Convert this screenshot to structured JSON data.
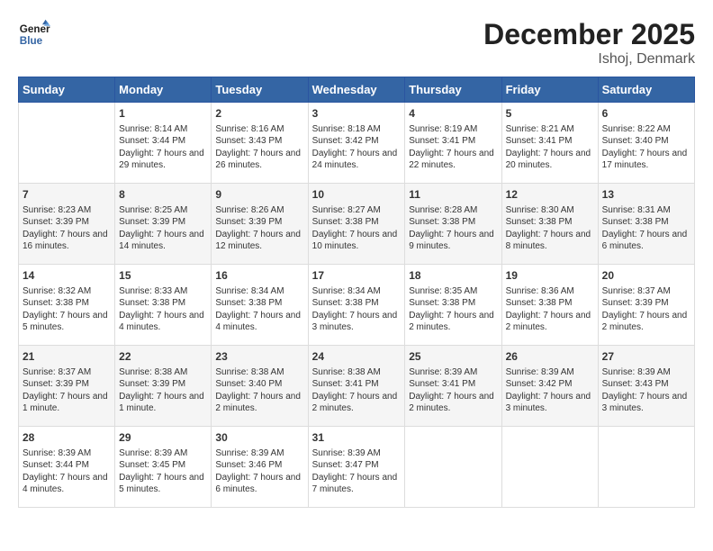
{
  "header": {
    "logo_line1": "General",
    "logo_line2": "Blue",
    "month_title": "December 2025",
    "location": "Ishoj, Denmark"
  },
  "weekdays": [
    "Sunday",
    "Monday",
    "Tuesday",
    "Wednesday",
    "Thursday",
    "Friday",
    "Saturday"
  ],
  "weeks": [
    [
      {
        "day": "",
        "sunrise": "",
        "sunset": "",
        "daylight": ""
      },
      {
        "day": "1",
        "sunrise": "Sunrise: 8:14 AM",
        "sunset": "Sunset: 3:44 PM",
        "daylight": "Daylight: 7 hours and 29 minutes."
      },
      {
        "day": "2",
        "sunrise": "Sunrise: 8:16 AM",
        "sunset": "Sunset: 3:43 PM",
        "daylight": "Daylight: 7 hours and 26 minutes."
      },
      {
        "day": "3",
        "sunrise": "Sunrise: 8:18 AM",
        "sunset": "Sunset: 3:42 PM",
        "daylight": "Daylight: 7 hours and 24 minutes."
      },
      {
        "day": "4",
        "sunrise": "Sunrise: 8:19 AM",
        "sunset": "Sunset: 3:41 PM",
        "daylight": "Daylight: 7 hours and 22 minutes."
      },
      {
        "day": "5",
        "sunrise": "Sunrise: 8:21 AM",
        "sunset": "Sunset: 3:41 PM",
        "daylight": "Daylight: 7 hours and 20 minutes."
      },
      {
        "day": "6",
        "sunrise": "Sunrise: 8:22 AM",
        "sunset": "Sunset: 3:40 PM",
        "daylight": "Daylight: 7 hours and 17 minutes."
      }
    ],
    [
      {
        "day": "7",
        "sunrise": "Sunrise: 8:23 AM",
        "sunset": "Sunset: 3:39 PM",
        "daylight": "Daylight: 7 hours and 16 minutes."
      },
      {
        "day": "8",
        "sunrise": "Sunrise: 8:25 AM",
        "sunset": "Sunset: 3:39 PM",
        "daylight": "Daylight: 7 hours and 14 minutes."
      },
      {
        "day": "9",
        "sunrise": "Sunrise: 8:26 AM",
        "sunset": "Sunset: 3:39 PM",
        "daylight": "Daylight: 7 hours and 12 minutes."
      },
      {
        "day": "10",
        "sunrise": "Sunrise: 8:27 AM",
        "sunset": "Sunset: 3:38 PM",
        "daylight": "Daylight: 7 hours and 10 minutes."
      },
      {
        "day": "11",
        "sunrise": "Sunrise: 8:28 AM",
        "sunset": "Sunset: 3:38 PM",
        "daylight": "Daylight: 7 hours and 9 minutes."
      },
      {
        "day": "12",
        "sunrise": "Sunrise: 8:30 AM",
        "sunset": "Sunset: 3:38 PM",
        "daylight": "Daylight: 7 hours and 8 minutes."
      },
      {
        "day": "13",
        "sunrise": "Sunrise: 8:31 AM",
        "sunset": "Sunset: 3:38 PM",
        "daylight": "Daylight: 7 hours and 6 minutes."
      }
    ],
    [
      {
        "day": "14",
        "sunrise": "Sunrise: 8:32 AM",
        "sunset": "Sunset: 3:38 PM",
        "daylight": "Daylight: 7 hours and 5 minutes."
      },
      {
        "day": "15",
        "sunrise": "Sunrise: 8:33 AM",
        "sunset": "Sunset: 3:38 PM",
        "daylight": "Daylight: 7 hours and 4 minutes."
      },
      {
        "day": "16",
        "sunrise": "Sunrise: 8:34 AM",
        "sunset": "Sunset: 3:38 PM",
        "daylight": "Daylight: 7 hours and 4 minutes."
      },
      {
        "day": "17",
        "sunrise": "Sunrise: 8:34 AM",
        "sunset": "Sunset: 3:38 PM",
        "daylight": "Daylight: 7 hours and 3 minutes."
      },
      {
        "day": "18",
        "sunrise": "Sunrise: 8:35 AM",
        "sunset": "Sunset: 3:38 PM",
        "daylight": "Daylight: 7 hours and 2 minutes."
      },
      {
        "day": "19",
        "sunrise": "Sunrise: 8:36 AM",
        "sunset": "Sunset: 3:38 PM",
        "daylight": "Daylight: 7 hours and 2 minutes."
      },
      {
        "day": "20",
        "sunrise": "Sunrise: 8:37 AM",
        "sunset": "Sunset: 3:39 PM",
        "daylight": "Daylight: 7 hours and 2 minutes."
      }
    ],
    [
      {
        "day": "21",
        "sunrise": "Sunrise: 8:37 AM",
        "sunset": "Sunset: 3:39 PM",
        "daylight": "Daylight: 7 hours and 1 minute."
      },
      {
        "day": "22",
        "sunrise": "Sunrise: 8:38 AM",
        "sunset": "Sunset: 3:39 PM",
        "daylight": "Daylight: 7 hours and 1 minute."
      },
      {
        "day": "23",
        "sunrise": "Sunrise: 8:38 AM",
        "sunset": "Sunset: 3:40 PM",
        "daylight": "Daylight: 7 hours and 2 minutes."
      },
      {
        "day": "24",
        "sunrise": "Sunrise: 8:38 AM",
        "sunset": "Sunset: 3:41 PM",
        "daylight": "Daylight: 7 hours and 2 minutes."
      },
      {
        "day": "25",
        "sunrise": "Sunrise: 8:39 AM",
        "sunset": "Sunset: 3:41 PM",
        "daylight": "Daylight: 7 hours and 2 minutes."
      },
      {
        "day": "26",
        "sunrise": "Sunrise: 8:39 AM",
        "sunset": "Sunset: 3:42 PM",
        "daylight": "Daylight: 7 hours and 3 minutes."
      },
      {
        "day": "27",
        "sunrise": "Sunrise: 8:39 AM",
        "sunset": "Sunset: 3:43 PM",
        "daylight": "Daylight: 7 hours and 3 minutes."
      }
    ],
    [
      {
        "day": "28",
        "sunrise": "Sunrise: 8:39 AM",
        "sunset": "Sunset: 3:44 PM",
        "daylight": "Daylight: 7 hours and 4 minutes."
      },
      {
        "day": "29",
        "sunrise": "Sunrise: 8:39 AM",
        "sunset": "Sunset: 3:45 PM",
        "daylight": "Daylight: 7 hours and 5 minutes."
      },
      {
        "day": "30",
        "sunrise": "Sunrise: 8:39 AM",
        "sunset": "Sunset: 3:46 PM",
        "daylight": "Daylight: 7 hours and 6 minutes."
      },
      {
        "day": "31",
        "sunrise": "Sunrise: 8:39 AM",
        "sunset": "Sunset: 3:47 PM",
        "daylight": "Daylight: 7 hours and 7 minutes."
      },
      {
        "day": "",
        "sunrise": "",
        "sunset": "",
        "daylight": ""
      },
      {
        "day": "",
        "sunrise": "",
        "sunset": "",
        "daylight": ""
      },
      {
        "day": "",
        "sunrise": "",
        "sunset": "",
        "daylight": ""
      }
    ]
  ],
  "colors": {
    "header_bg": "#3465a4",
    "accent": "#1a5fb4"
  }
}
